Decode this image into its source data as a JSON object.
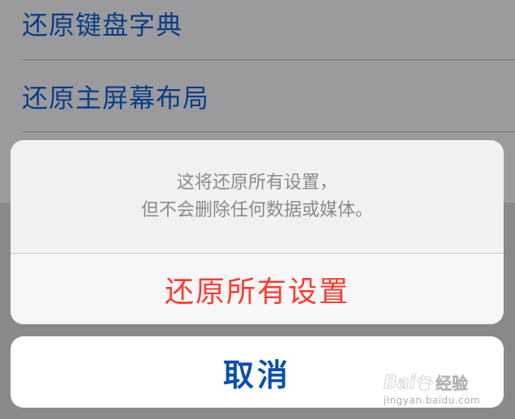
{
  "settings_list": {
    "items": [
      {
        "label": "还原键盘字典"
      },
      {
        "label": "还原主屏幕布局"
      }
    ]
  },
  "action_sheet": {
    "message_lines": [
      "这将还原所有设置，",
      "但不会删除任何数据或媒体。"
    ],
    "destructive_label": "还原所有设置"
  },
  "cancel": {
    "label": "取消"
  },
  "watermark": {
    "logo_text": "Bai 经验",
    "url": "jingyan.baidu.com"
  },
  "colors": {
    "destructive": "#ff3b30",
    "cancel": "#0a4fb0",
    "list_text": "#0a3e86"
  }
}
